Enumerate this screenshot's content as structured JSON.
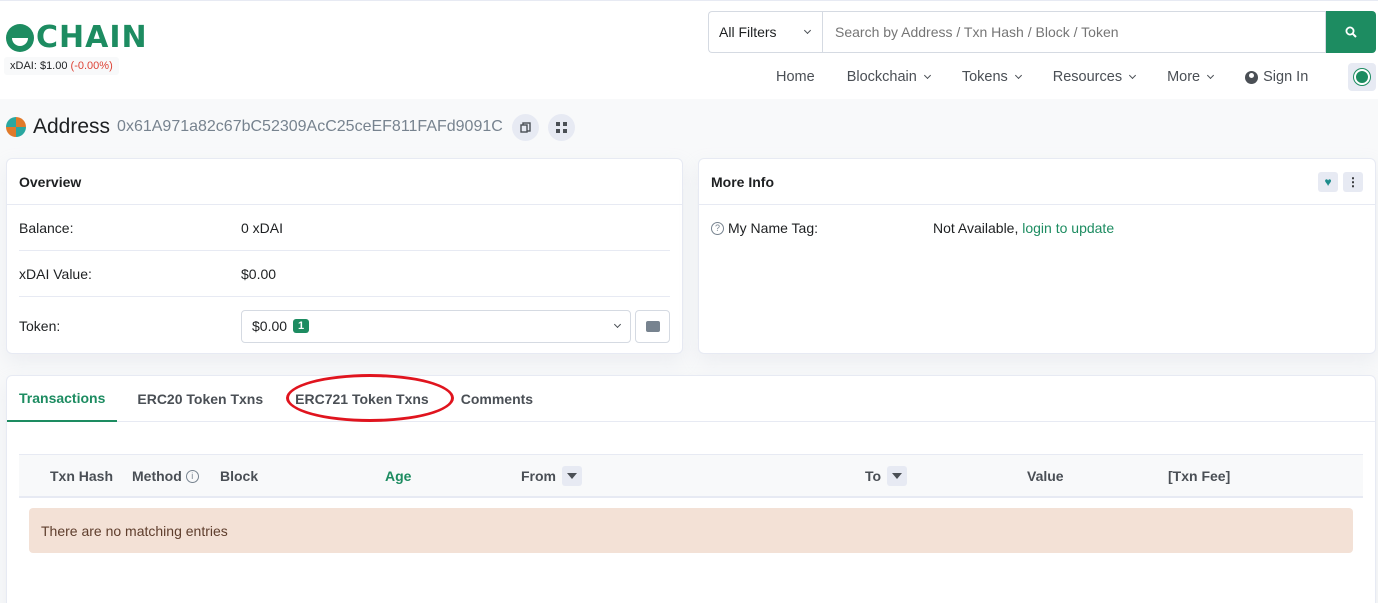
{
  "brand": {
    "logo_text": "CHAIN",
    "price_label": "xDAI: $1.00",
    "price_change": "(-0.00%)",
    "accent": "#1d8c61"
  },
  "search": {
    "filter_label": "All Filters",
    "placeholder": "Search by Address / Txn Hash / Block / Token"
  },
  "nav": {
    "home": "Home",
    "blockchain": "Blockchain",
    "tokens": "Tokens",
    "resources": "Resources",
    "more": "More",
    "sign_in": "Sign In"
  },
  "address": {
    "label": "Address",
    "hash": "0x61A971a82c67bC52309AcC25ceEF811FAFd9091C"
  },
  "overview": {
    "title": "Overview",
    "balance_label": "Balance:",
    "balance_value": "0 xDAI",
    "value_label": "xDAI Value:",
    "value_value": "$0.00",
    "token_label": "Token:",
    "token_value": "$0.00",
    "token_count": "1"
  },
  "more_info": {
    "title": "More Info",
    "name_tag_label": "My Name Tag:",
    "name_tag_value": "Not Available,",
    "name_tag_link": "login to update"
  },
  "tabs": [
    "Transactions",
    "ERC20 Token Txns",
    "ERC721 Token Txns",
    "Comments"
  ],
  "table": {
    "headers": [
      "Txn Hash",
      "Method",
      "Block",
      "Age",
      "From",
      "To",
      "Value",
      "[Txn Fee]"
    ],
    "empty_message": "There are no matching entries"
  }
}
